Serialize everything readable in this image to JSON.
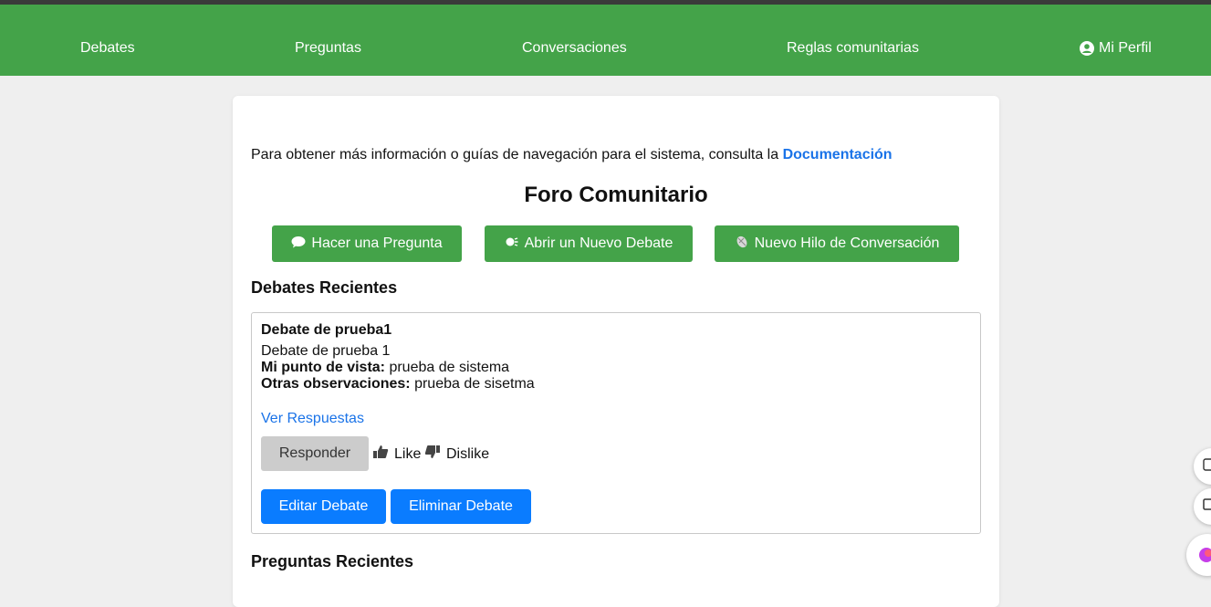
{
  "nav": {
    "debates": "Debates",
    "preguntas": "Preguntas",
    "conversaciones": "Conversaciones",
    "reglas": "Reglas comunitarias",
    "perfil": "Mi Perfil"
  },
  "info": {
    "text": "Para obtener más información o guías de navegación para el sistema, consulta la ",
    "link": "Documentación"
  },
  "title": "Foro Comunitario",
  "actions": {
    "pregunta": "Hacer una Pregunta",
    "debate": "Abrir un Nuevo Debate",
    "hilo": "Nuevo Hilo de Conversación"
  },
  "sections": {
    "debates": "Debates Recientes",
    "preguntas": "Preguntas Recientes"
  },
  "debate": {
    "title": "Debate de prueba1",
    "description": "Debate de prueba 1",
    "view_label": "Mi punto de vista:",
    "view_value": " prueba de sistema",
    "obs_label": "Otras observaciones:",
    "obs_value": " prueba de sisetma",
    "ver_respuestas": "Ver Respuestas",
    "responder": "Responder",
    "like": "Like",
    "dislike": "Dislike",
    "editar": "Editar Debate",
    "eliminar": "Eliminar Debate"
  },
  "colors": {
    "nav_green": "#44a349",
    "link_blue": "#1a73e8",
    "button_blue": "#0a7cff"
  }
}
